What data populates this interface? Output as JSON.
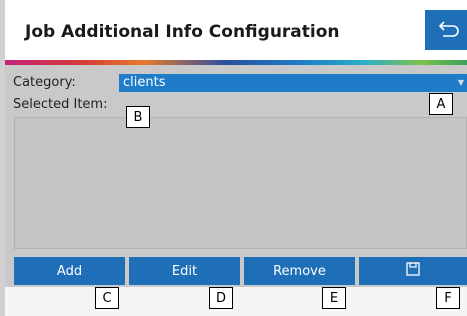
{
  "header": {
    "title": "Job Additional Info Configuration"
  },
  "form": {
    "category_label": "Category:",
    "category_value": "clients",
    "selected_item_label": "Selected Item:"
  },
  "buttons": {
    "add": "Add",
    "edit": "Edit",
    "remove": "Remove"
  },
  "icons": {
    "back": "back-arrow-icon",
    "save": "floppy-disk-icon",
    "dropdown": "dropdown-caret-icon"
  },
  "callouts": [
    "A",
    "B",
    "C",
    "D",
    "E",
    "F"
  ],
  "colors": {
    "accent": "#1f6fb8",
    "select": "#1e7cc8",
    "panel": "#c9c9c9"
  }
}
